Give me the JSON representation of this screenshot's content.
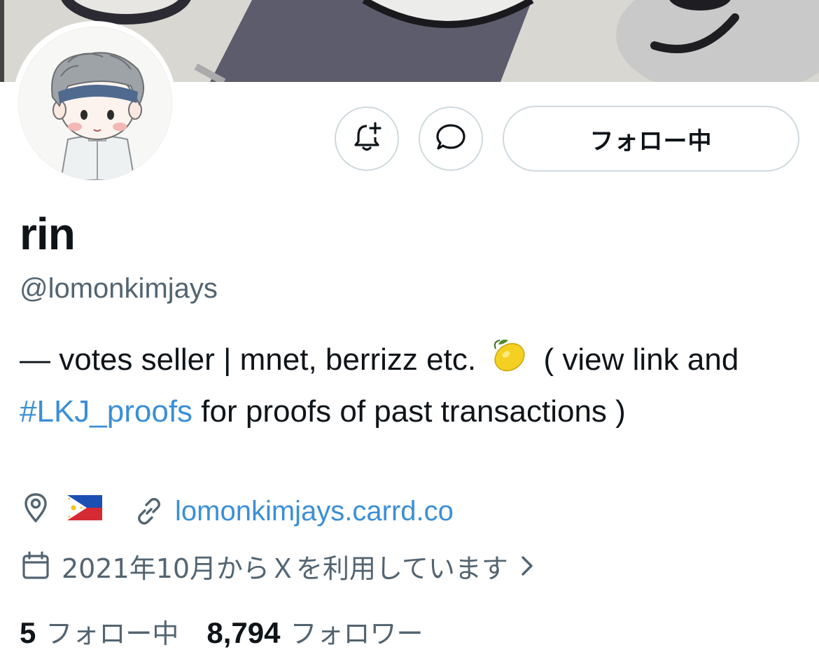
{
  "profile": {
    "name": "rin",
    "handle": "@lomonkimjays",
    "bio": {
      "part1": "— votes seller | mnet, berrizz etc. ",
      "part2": " ( view link and ",
      "hashtag": "#LKJ_proofs",
      "part3": " for proofs of past transactions )"
    },
    "location_icon": "map-pin-icon",
    "location_flag": "philippines-flag",
    "website": "lomonkimjays.carrd.co",
    "joined": "2021年10月からＸを利用しています",
    "following_count": "5",
    "following_label": "フォロー中",
    "followers_count": "8,794",
    "followers_label": "フォロワー"
  },
  "actions": {
    "notify_icon": "bell-plus-icon",
    "message_icon": "speech-bubble-icon",
    "follow_label": "フォロー中"
  },
  "colors": {
    "link": "#3b8fd6",
    "secondary_text": "#536471",
    "border": "#cfd9de"
  }
}
